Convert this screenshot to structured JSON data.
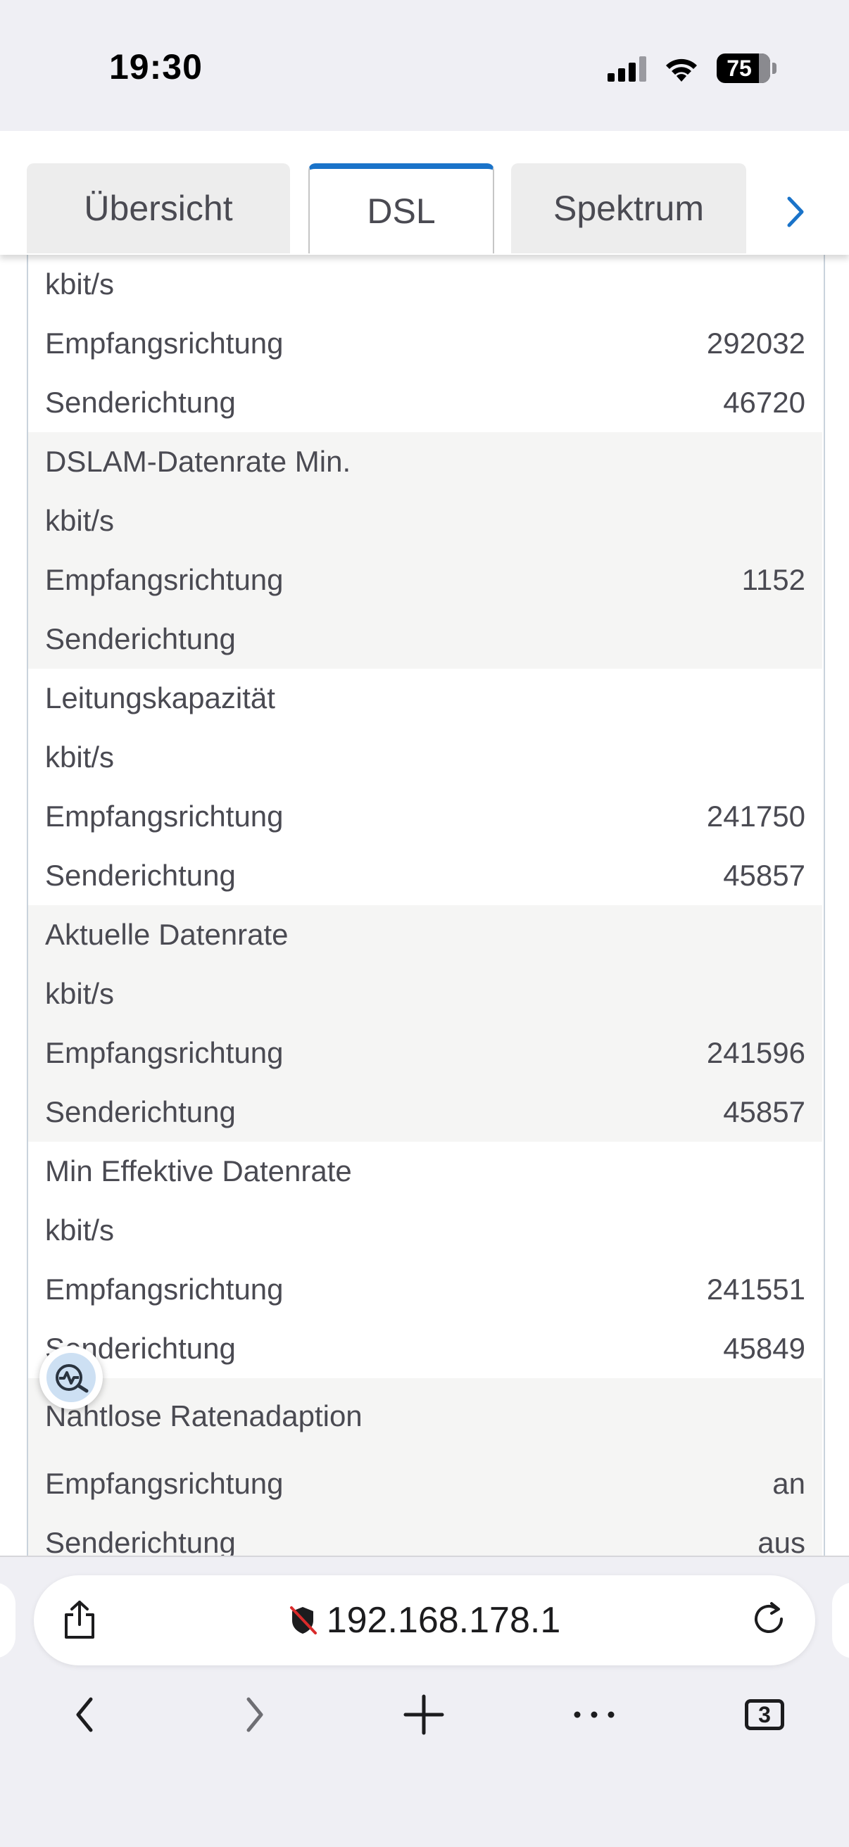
{
  "status_bar": {
    "time": "19:30",
    "battery": "75"
  },
  "tabs": [
    {
      "label": "Übersicht",
      "active": false
    },
    {
      "label": "DSL",
      "active": true
    },
    {
      "label": "Spektrum",
      "active": false
    }
  ],
  "groups": [
    {
      "alt": false,
      "rows": [
        {
          "label": "kbit/s",
          "value": ""
        },
        {
          "label": "Empfangsrichtung",
          "value": "292032"
        },
        {
          "label": "Senderichtung",
          "value": "46720"
        }
      ]
    },
    {
      "alt": true,
      "rows": [
        {
          "label": "DSLAM-Datenrate Min.",
          "value": ""
        },
        {
          "label": "kbit/s",
          "value": ""
        },
        {
          "label": "Empfangsrichtung",
          "value": "1152"
        },
        {
          "label": "Senderichtung",
          "value": ""
        }
      ]
    },
    {
      "alt": false,
      "rows": [
        {
          "label": "Leitungskapazität",
          "value": ""
        },
        {
          "label": "kbit/s",
          "value": ""
        },
        {
          "label": "Empfangsrichtung",
          "value": "241750"
        },
        {
          "label": "Senderichtung",
          "value": "45857"
        }
      ]
    },
    {
      "alt": true,
      "rows": [
        {
          "label": "Aktuelle Datenrate",
          "value": ""
        },
        {
          "label": "kbit/s",
          "value": ""
        },
        {
          "label": "Empfangsrichtung",
          "value": "241596"
        },
        {
          "label": "Senderichtung",
          "value": "45857"
        }
      ]
    },
    {
      "alt": false,
      "rows": [
        {
          "label": "Min Effektive Datenrate",
          "value": ""
        },
        {
          "label": "kbit/s",
          "value": ""
        },
        {
          "label": "Empfangsrichtung",
          "value": "241551"
        },
        {
          "label": "Senderichtung",
          "value": "45849"
        }
      ]
    },
    {
      "alt": true,
      "rows": [
        {
          "label": "Nahtlose Ratenadaption",
          "value": "",
          "tall": true
        },
        {
          "label": "Empfangsrichtung",
          "value": "an"
        },
        {
          "label": "Senderichtung",
          "value": "aus"
        }
      ]
    }
  ],
  "browser": {
    "url": "192.168.178.1",
    "tab_count": "3"
  },
  "colors": {
    "accent": "#1a73c9",
    "alt_row": "#f5f5f4",
    "text": "#4a4a52"
  },
  "icons": [
    "signal-icon",
    "wifi-icon",
    "battery-icon",
    "chevron-right-icon",
    "network-diagnostics-icon",
    "share-icon",
    "not-secure-icon",
    "reload-icon",
    "back-icon",
    "forward-icon",
    "plus-icon",
    "more-icon",
    "tabs-icon"
  ]
}
